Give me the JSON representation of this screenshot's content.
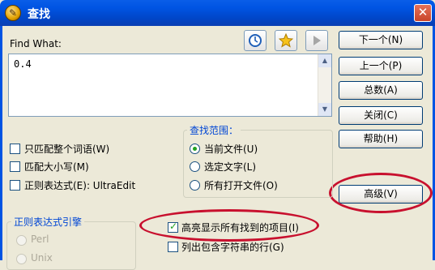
{
  "window": {
    "title": "查找",
    "close_glyph": "✕"
  },
  "find": {
    "label": "Find What:",
    "value": "0.4"
  },
  "toolbar": {
    "clock_icon": "clock-icon",
    "star_icon": "star-icon",
    "play_icon": "play-icon"
  },
  "buttons": {
    "find_next": "下一个(N)",
    "find_prev": "上一个(P)",
    "count": "总数(A)",
    "close": "关闭(C)",
    "help": "帮助(H)",
    "advanced": "高级(V)"
  },
  "options": {
    "match_word": "只匹配整个词语(W)",
    "match_case": "匹配大小写(M)",
    "regex": "正则表达式(E): UltraEdit"
  },
  "scope": {
    "legend": "查找范围：",
    "items": [
      "当前文件(U)",
      "选定文字(L)",
      "所有打开文件(O)"
    ],
    "selected_index": 0
  },
  "regex_engine": {
    "legend": "正则表达式引擎",
    "items": [
      "Perl",
      "Unix"
    ]
  },
  "extra": {
    "highlight_all": "高亮显示所有找到的项目(I)",
    "highlight_all_checked": true,
    "list_lines": "列出包含字符串的行(G)",
    "list_lines_checked": false
  },
  "accent": {
    "title_blue": "#0054e3",
    "annotation_red": "#c8102e"
  }
}
